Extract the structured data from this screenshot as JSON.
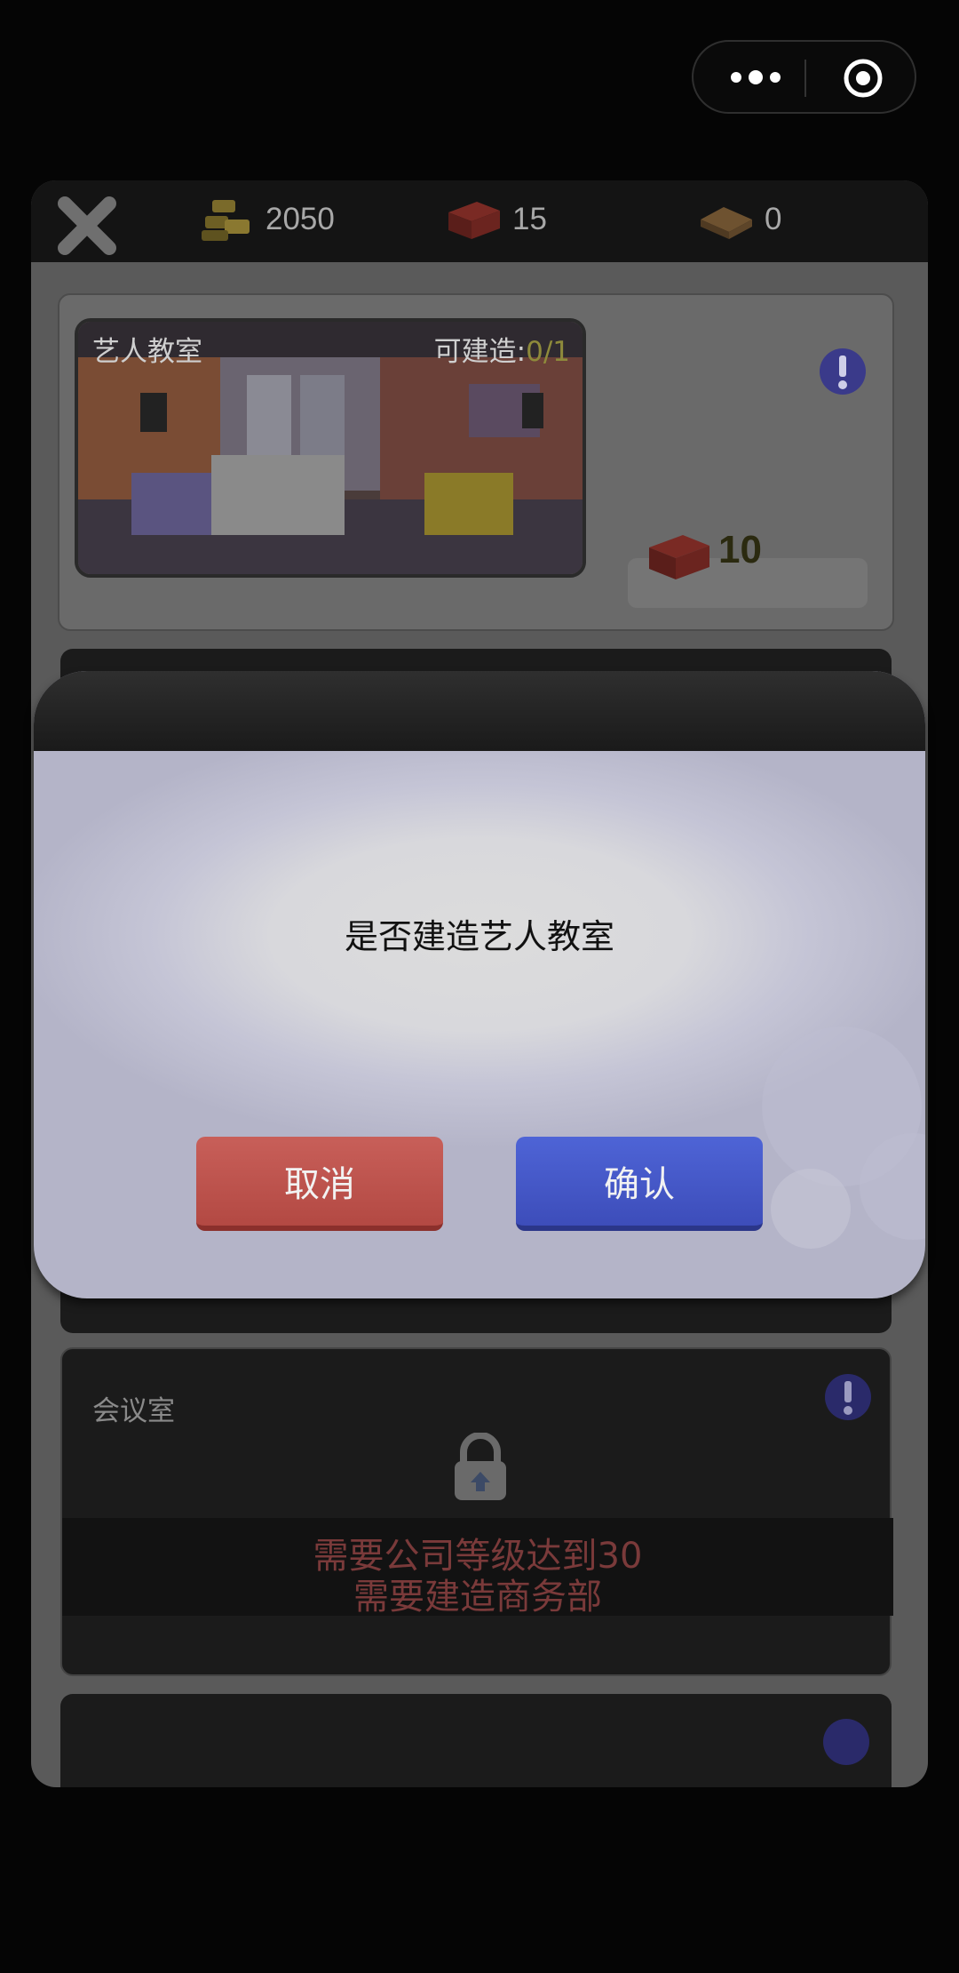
{
  "capsule": {
    "more_icon": "more-dots-icon",
    "close_icon": "target-circle-icon"
  },
  "topbar": {
    "close_icon": "close-x-icon",
    "resources": [
      {
        "icon": "gold-bars-icon",
        "value": "2050"
      },
      {
        "icon": "red-brick-icon",
        "value": "15"
      },
      {
        "icon": "wood-plank-icon",
        "value": "0"
      }
    ]
  },
  "buildings": [
    {
      "name": "艺人教室",
      "available_label": "可建造:",
      "available_value": "0/1",
      "cost_icon": "red-brick-icon",
      "cost": "10"
    },
    {
      "name": "会议室",
      "requirements": [
        "需要公司等级达到30",
        "需要建造商务部"
      ]
    }
  ],
  "dialog": {
    "message": "是否建造艺人教室",
    "cancel_label": "取消",
    "confirm_label": "确认"
  },
  "colors": {
    "cancel": "#c0534d",
    "confirm": "#4656c8",
    "panel": "#5a5a5a"
  }
}
